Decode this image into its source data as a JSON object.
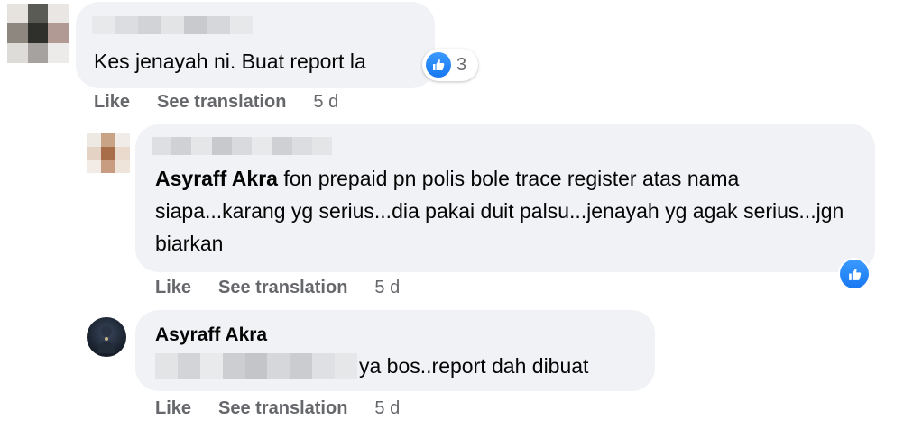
{
  "comments": [
    {
      "text": "Kes jenayah ni. Buat report la",
      "reaction_count": "3",
      "actions": {
        "like": "Like",
        "translate": "See translation",
        "time": "5 d"
      }
    },
    {
      "mention": "Asyraff Akra",
      "text": " fon prepaid pn polis bole trace register atas nama siapa...karang yg serius...dia pakai duit palsu...jenayah yg agak serius...jgn biarkan",
      "actions": {
        "like": "Like",
        "translate": "See translation",
        "time": "5 d"
      }
    },
    {
      "author": "Asyraff Akra",
      "text": "ya bos..report dah dibuat",
      "actions": {
        "like": "Like",
        "translate": "See translation",
        "time": "5 d"
      }
    }
  ],
  "icons": {
    "like": "thumbs-up-icon"
  },
  "colors": {
    "bubble": "#f0f2f5",
    "like_blue": "#1877f2",
    "muted": "#65676b"
  }
}
